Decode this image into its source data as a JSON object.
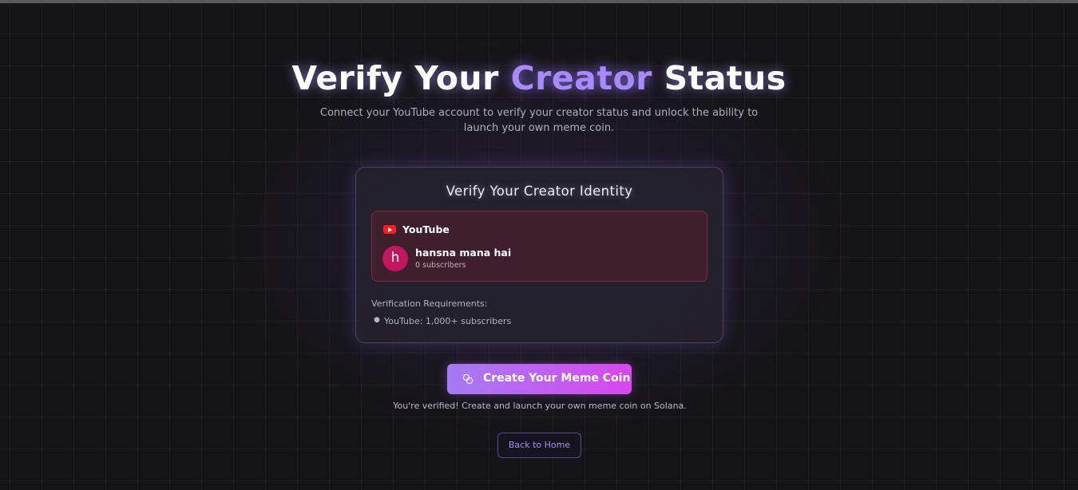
{
  "hero": {
    "title_before": "Verify Your ",
    "title_accent": "Creator",
    "title_after": " Status",
    "subtitle": "Connect your YouTube account to verify your creator status and unlock the ability to launch your own meme coin."
  },
  "card": {
    "title": "Verify Your Creator Identity",
    "account": {
      "platform": "YouTube",
      "platform_icon": "youtube-icon",
      "avatar_initial": "h",
      "channel_name": "hansna mana hai",
      "subscribers": "0 subscribers"
    },
    "requirements": {
      "heading": "Verification Requirements:",
      "items": [
        "YouTube: 1,000+ subscribers"
      ]
    }
  },
  "actions": {
    "create_label": "Create Your Meme Coin",
    "create_icon": "coin-icon",
    "verified_note": "You're verified! Create and launch your own meme coin on Solana.",
    "back_label": "Back to Home"
  },
  "colors": {
    "accent": "#a78bfa",
    "youtube_red": "#ff1e1e",
    "avatar_bg": "#c2185b",
    "button_gradient_start": "#a47cf3",
    "button_gradient_end": "#d946ef"
  }
}
